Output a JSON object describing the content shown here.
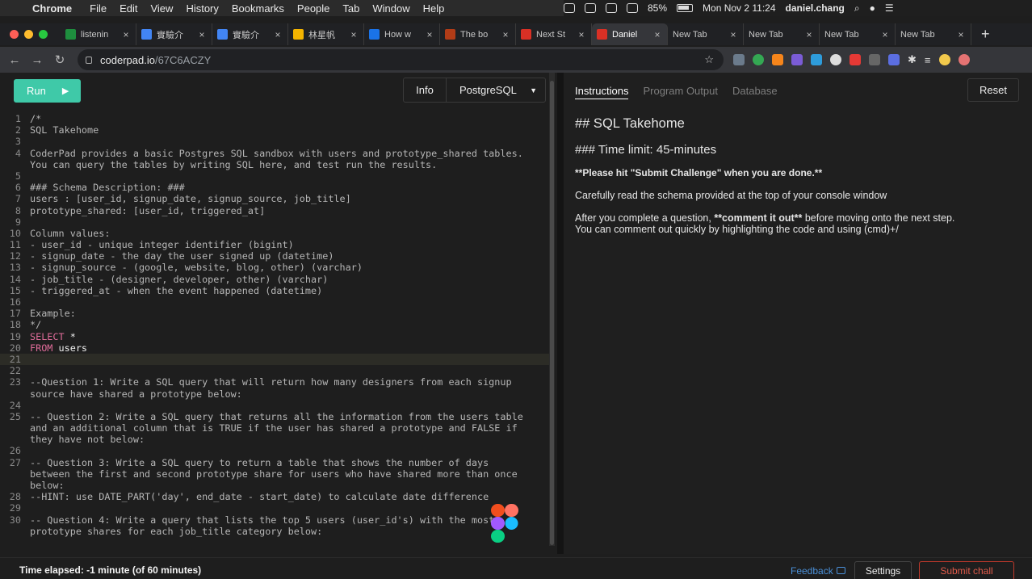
{
  "menubar": {
    "app": "Chrome",
    "items": [
      "File",
      "Edit",
      "View",
      "History",
      "Bookmarks",
      "People",
      "Tab",
      "Window",
      "Help"
    ],
    "battery": "85%",
    "clock": "Mon Nov 2  11:24",
    "user": "daniel.chang"
  },
  "tabs": [
    {
      "title": "listenin",
      "color": "#1e8e3e"
    },
    {
      "title": "實驗介",
      "color": "#4285f4"
    },
    {
      "title": "實驗介",
      "color": "#4285f4"
    },
    {
      "title": "林星帆",
      "color": "#f4b400"
    },
    {
      "title": "How w",
      "color": "#1a73e8"
    },
    {
      "title": "The bo",
      "color": "#b23c17"
    },
    {
      "title": "Next St",
      "color": "#d93025"
    },
    {
      "title": "Daniel",
      "color": "#d93025"
    },
    {
      "title": "New Tab",
      "color": ""
    },
    {
      "title": "New Tab",
      "color": ""
    },
    {
      "title": "New Tab",
      "color": ""
    },
    {
      "title": "New Tab",
      "color": ""
    }
  ],
  "address": {
    "host": "coderpad.io",
    "path": "/67C6ACZY"
  },
  "editor": {
    "run_label": "Run",
    "info_label": "Info",
    "language": "PostgreSQL",
    "lines": [
      {
        "n": "1",
        "t": "/*"
      },
      {
        "n": "2",
        "t": "SQL Takehome"
      },
      {
        "n": "3",
        "t": ""
      },
      {
        "n": "4",
        "t": "CoderPad provides a basic Postgres SQL sandbox with users and prototype_shared tables."
      },
      {
        "n": "",
        "t": "You can query the tables by writing SQL here, and test run the results."
      },
      {
        "n": "5",
        "t": ""
      },
      {
        "n": "6",
        "t": "### Schema Description: ###"
      },
      {
        "n": "7",
        "t": "users : [user_id, signup_date, signup_source, job_title]"
      },
      {
        "n": "8",
        "t": "prototype_shared: [user_id, triggered_at]"
      },
      {
        "n": "9",
        "t": ""
      },
      {
        "n": "10",
        "t": "Column values:"
      },
      {
        "n": "11",
        "t": "- user_id - unique integer identifier (bigint)"
      },
      {
        "n": "12",
        "t": "- signup_date - the day the user signed up (datetime)"
      },
      {
        "n": "13",
        "t": "- signup_source - (google, website, blog, other) (varchar)"
      },
      {
        "n": "14",
        "t": "- job_title - (designer, developer, other) (varchar)"
      },
      {
        "n": "15",
        "t": "- triggered_at - when the event happened (datetime)"
      },
      {
        "n": "16",
        "t": ""
      },
      {
        "n": "17",
        "t": "Example:"
      },
      {
        "n": "18",
        "t": "*/"
      },
      {
        "n": "19",
        "kw": "SELECT",
        "rest": " *"
      },
      {
        "n": "20",
        "kw": "FROM",
        "rest": " users"
      },
      {
        "n": "21",
        "t": "",
        "hl": true
      },
      {
        "n": "22",
        "t": ""
      },
      {
        "n": "23",
        "t": "--Question 1: Write a SQL query that will return how many designers from each signup"
      },
      {
        "n": "",
        "t": "source have shared a prototype below:"
      },
      {
        "n": "24",
        "t": ""
      },
      {
        "n": "25",
        "t": "-- Question 2: Write a SQL query that returns all the information from the users table"
      },
      {
        "n": "",
        "t": "and an additional column that is TRUE if the user has shared a prototype and FALSE if"
      },
      {
        "n": "",
        "t": "they have not below:"
      },
      {
        "n": "26",
        "t": ""
      },
      {
        "n": "27",
        "t": "-- Question 3: Write a SQL query to return a table that shows the number of days"
      },
      {
        "n": "",
        "t": "between the first and second prototype share for users who have shared more than once"
      },
      {
        "n": "",
        "t": "below:"
      },
      {
        "n": "28",
        "t": "--HINT: use DATE_PART('day', end_date - start_date) to calculate date difference"
      },
      {
        "n": "29",
        "t": ""
      },
      {
        "n": "30",
        "t": "-- Question 4: Write a query that lists the top 5 users (user_id's) with the most"
      },
      {
        "n": "",
        "t": "prototype shares for each job_title category below:"
      }
    ]
  },
  "panel": {
    "tabs": [
      "Instructions",
      "Program Output",
      "Database"
    ],
    "reset_label": "Reset",
    "h2": "## SQL Takehome",
    "h3": "### Time limit: 45-minutes",
    "notice": "**Please hit \"Submit Challenge\" when you are done.**",
    "p1": "Carefully read the schema provided at the top of your console window",
    "p2_before": "After you complete a question, ",
    "p2_bold": "**comment it out**",
    "p2_after": " before moving onto the next step.",
    "p3": "You can comment out quickly by highlighting the code and using (cmd)+/"
  },
  "footer": {
    "elapsed": "Time elapsed: -1 minute (of 60 minutes)",
    "feedback": "Feedback",
    "settings": "Settings",
    "submit": "Submit chall"
  }
}
